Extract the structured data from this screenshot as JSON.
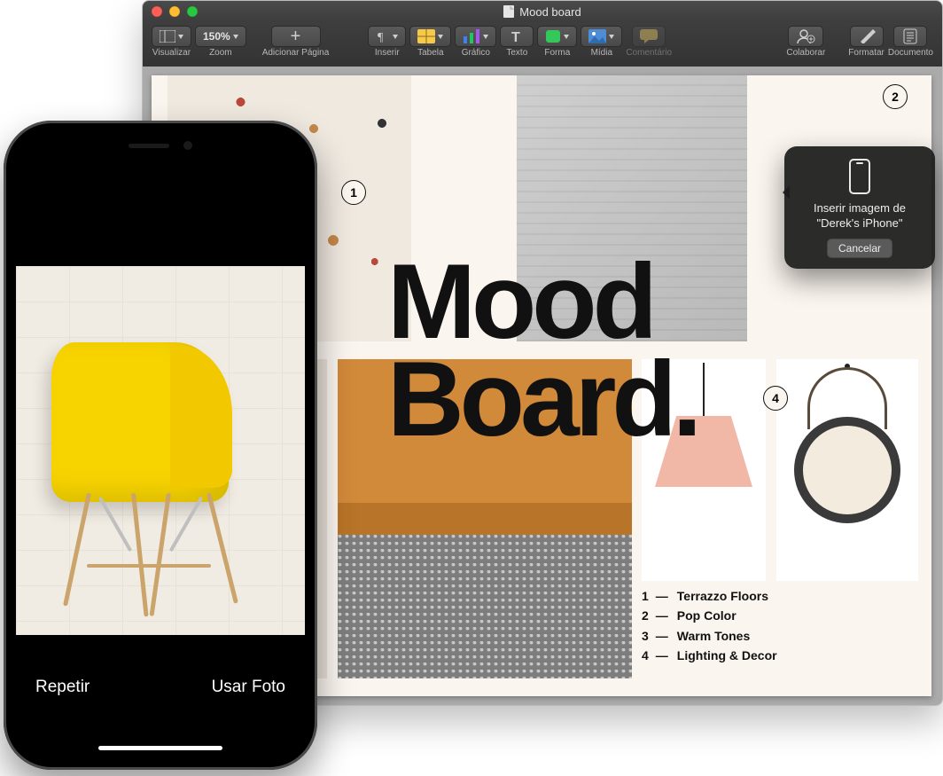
{
  "window": {
    "title": "Mood board"
  },
  "toolbar": {
    "view": "Visualizar",
    "zoom": "Zoom",
    "zoom_value": "150%",
    "add_page": "Adicionar Página",
    "insert": "Inserir",
    "table": "Tabela",
    "chart": "Gráfico",
    "text": "Texto",
    "shape": "Forma",
    "media": "Mídia",
    "comment": "Comentário",
    "collab": "Colaborar",
    "format": "Formatar",
    "document": "Documento"
  },
  "document": {
    "title_line1": "Mood",
    "title_line2": "Board.",
    "callouts": {
      "c1": "1",
      "c2": "2",
      "c4": "4"
    },
    "legend": [
      {
        "n": "1",
        "label": "Terrazzo Floors"
      },
      {
        "n": "2",
        "label": "Pop Color"
      },
      {
        "n": "3",
        "label": "Warm Tones"
      },
      {
        "n": "4",
        "label": "Lighting & Decor"
      }
    ]
  },
  "popover": {
    "line1": "Inserir imagem de",
    "line2": "\"Derek's iPhone\"",
    "cancel": "Cancelar"
  },
  "iphone": {
    "retake": "Repetir",
    "use": "Usar Foto"
  }
}
